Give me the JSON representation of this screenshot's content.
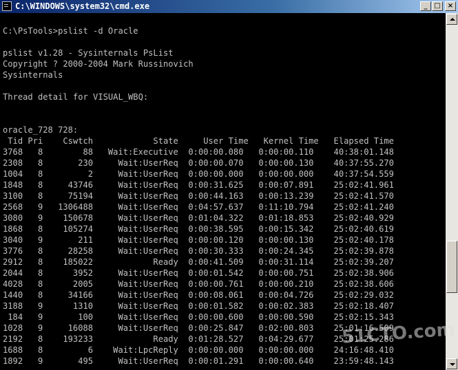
{
  "window": {
    "title": "C:\\WINDOWS\\system32\\cmd.exe",
    "buttons": {
      "minimize": "_",
      "maximize": "□",
      "close": "×"
    }
  },
  "console": {
    "lines": [
      "",
      "C:\\PsTools>pslist -d Oracle",
      "",
      "pslist v1.28 - Sysinternals PsList",
      "Copyright ? 2000-2004 Mark Russinovich",
      "Sysinternals",
      "",
      "Thread detail for VISUAL_WBQ:",
      "",
      "",
      "oracle_728 728:",
      " Tid Pri    Cswtch            State     User Time   Kernel Time   Elapsed Time",
      "3768   8        88   Wait:Executive  0:00:00.080   0:00:00.110    40:38:01.148",
      "2308   8       230     Wait:UserReq  0:00:00.070   0:00:00.130    40:37:55.270",
      "1004   8         2     Wait:UserReq  0:00:00.000   0:00:00.000    40:37:54.559",
      "1848   8     43746     Wait:UserReq  0:00:31.625   0:00:07.891    25:02:41.961",
      "3100   8     75194     Wait:UserReq  0:00:44.163   0:00:13.239    25:02:41.570",
      "2568   9   1306488     Wait:UserReq  0:04:57.637   0:11:10.794    25:02:41.240",
      "3080   9    150678     Wait:UserReq  0:01:04.322   0:01:18.853    25:02:40.929",
      "1868   8    105274     Wait:UserReq  0:00:38.595   0:00:15.342    25:02:40.619",
      "3040   9       211     Wait:UserReq  0:00:00.120   0:00:00.130    25:02:40.178",
      "3776   8     28258     Wait:UserReq  0:00:30.333   0:00:24.345    25:02:39.878",
      "2912   8    185022            Ready  0:00:41.509   0:00:31.114    25:02:39.207",
      "2044   8      3952     Wait:UserReq  0:00:01.542   0:00:00.751    25:02:38.906",
      "4028   8      2005     Wait:UserReq  0:00:00.761   0:00:00.210    25:02:38.606",
      "1440   8     34166     Wait:UserReq  0:00:08.061   0:00:04.726    25:02:29.032",
      "3188   9      1310     Wait:UserReq  0:00:01.582   0:00:02.383    25:02:18.407",
      " 184   9       100     Wait:UserReq  0:00:00.600   0:00:00.590    25:02:15.343",
      "1028   9     16088     Wait:UserReq  0:00:25.847   0:02:00.803    25:01:16.509",
      "2192   8    193233            Ready  0:01:28.527   0:04:29.677    25:01:25.286",
      "1688   8         6    Wait:LpcReply  0:00:00.000   0:00:00.000    24:16:48.410",
      "1892   9       495     Wait:UserReq  0:00:01.291   0:00:00.640    23:59:48.143"
    ]
  },
  "watermark": "51CTO.com"
}
